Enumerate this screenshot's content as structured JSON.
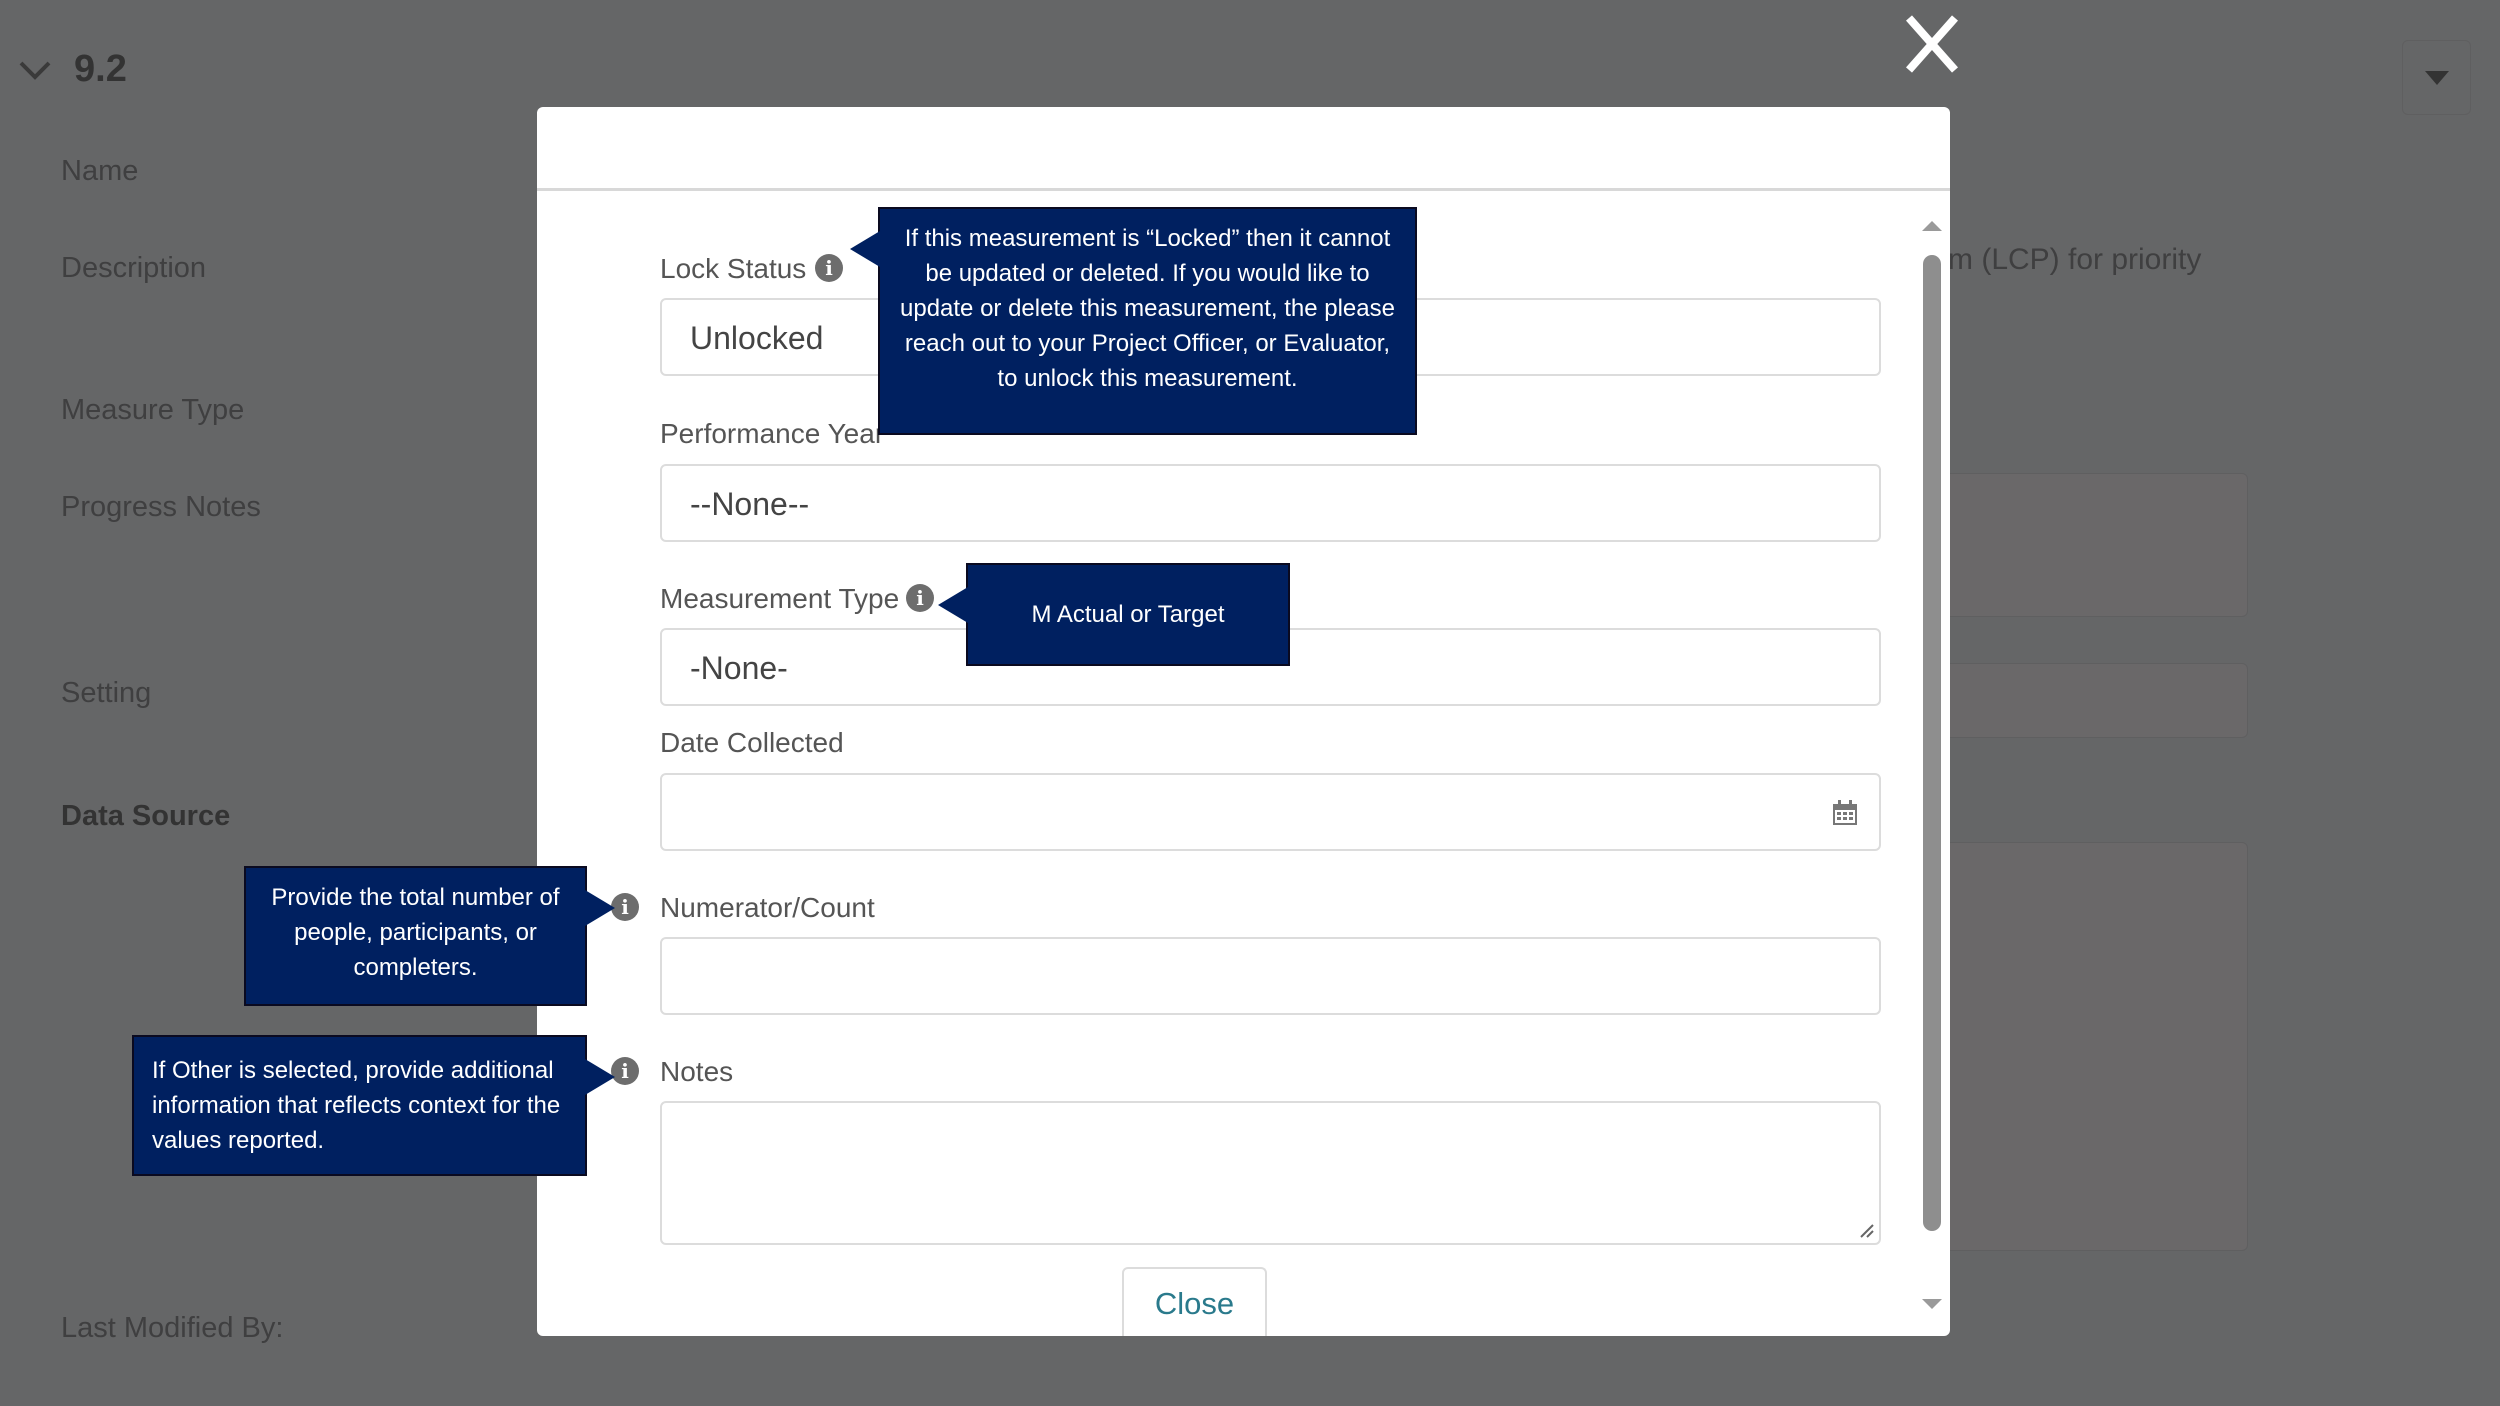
{
  "background": {
    "section_title": "9.2",
    "labels": [
      "Name",
      "Description",
      "Measure Type",
      "Progress Notes",
      "Setting",
      "Data Source",
      "Last Modified By:"
    ],
    "description_fragment": "m (LCP) for priority"
  },
  "modal": {
    "fields": {
      "lock_status": {
        "label": "Lock Status",
        "value": "Unlocked"
      },
      "performance_year": {
        "label": "Performance Year",
        "value": "--None--"
      },
      "measurement_type": {
        "label": "Measurement Type",
        "value": "-None-"
      },
      "date_collected": {
        "label": "Date Collected",
        "value": ""
      },
      "numerator": {
        "label": "Numerator/Count",
        "value": ""
      },
      "notes": {
        "label": "Notes",
        "value": ""
      }
    },
    "close_label": "Close"
  },
  "tooltips": {
    "lock": "If this measurement is “Locked” then it cannot be updated or deleted. If you would like to update or  delete this measurement, the please reach out to your Project Officer, or Evaluator, to unlock this measurement.",
    "measurement_type": "M Actual or Target",
    "numerator": "Provide the total number of people, participants, or completers.",
    "notes": "If Other is selected, provide additional information that reflects context for the values reported."
  },
  "colors": {
    "tooltip_bg": "#002060",
    "overlay": "#656667"
  }
}
